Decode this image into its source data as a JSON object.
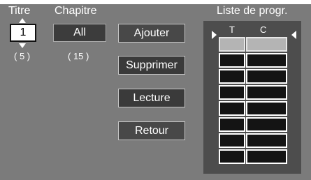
{
  "header": {
    "titre_label": "Titre",
    "chapitre_label": "Chapitre",
    "list_label": "Liste de progr."
  },
  "titre": {
    "value": "1",
    "count": "( 5 )"
  },
  "chapitre": {
    "value": "All",
    "count": "( 15 )"
  },
  "buttons": {
    "add": "Ajouter",
    "delete": "Supprimer",
    "play": "Lecture",
    "back": "Retour"
  },
  "program_list": {
    "col_t": "T",
    "col_c": "C",
    "row_count": 8,
    "selected_row": 1
  }
}
